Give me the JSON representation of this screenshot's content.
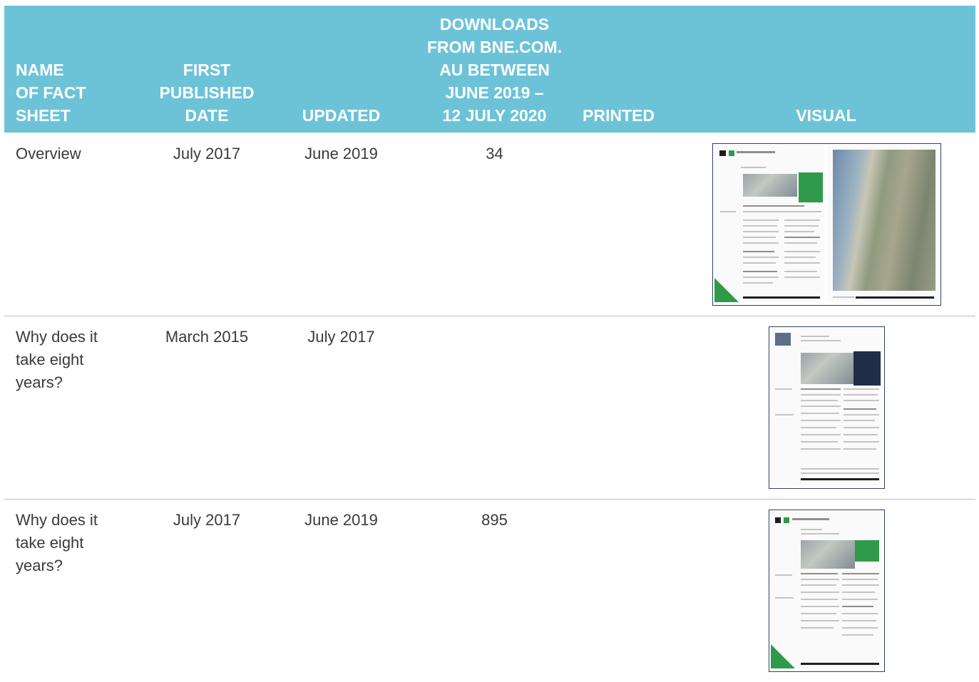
{
  "table": {
    "headers": {
      "name": [
        "NAME",
        "OF FACT",
        "SHEET"
      ],
      "first_published": [
        "FIRST",
        "PUBLISHED",
        "DATE"
      ],
      "updated": "UPDATED",
      "downloads": [
        "DOWNLOADS",
        "FROM BNE.COM.",
        "AU BETWEEN",
        "JUNE 2019 –",
        "12 JULY 2020"
      ],
      "printed": "PRINTED",
      "visual": "VISUAL"
    },
    "rows": [
      {
        "name": "Overview",
        "first_published": "July 2017",
        "updated": "June 2019",
        "downloads": "34",
        "printed": "",
        "visual": "overview-fact-sheet-thumbnail"
      },
      {
        "name": "Why does it take eight years?",
        "first_published": "March 2015",
        "updated": "July 2017",
        "downloads": "",
        "printed": "",
        "visual": "why-eight-years-2015-fact-sheet-thumbnail"
      },
      {
        "name": "Why does it take eight years?",
        "first_published": "July 2017",
        "updated": "June 2019",
        "downloads": "895",
        "printed": "",
        "visual": "why-eight-years-2017-fact-sheet-thumbnail"
      }
    ]
  },
  "colors": {
    "header_background": "#6cc3d8",
    "header_text": "#ffffff",
    "body_text": "#3a3a3a",
    "row_divider": "#b9b9b9",
    "runway_green": "#2f9a4a",
    "thumbnail_border": "#2a3f66"
  }
}
